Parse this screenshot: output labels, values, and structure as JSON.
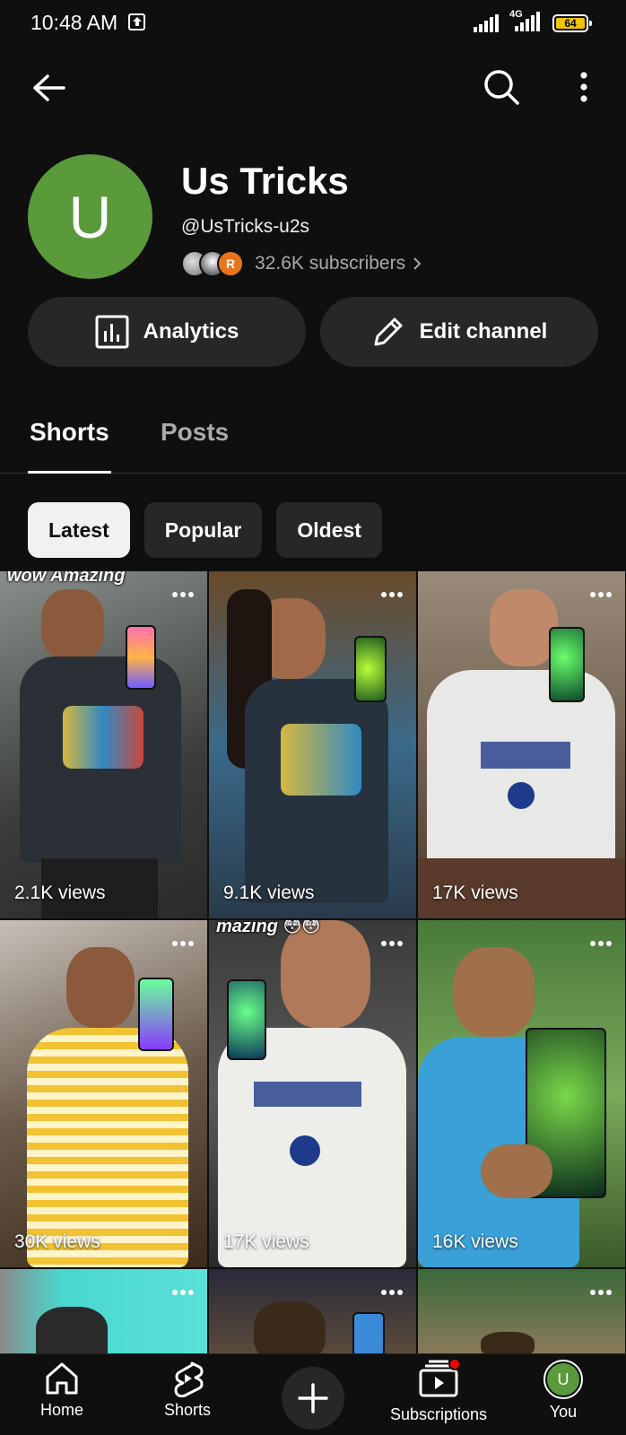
{
  "status_bar": {
    "time": "10:48 AM",
    "network": "4G",
    "battery": "64"
  },
  "top_bar": {
    "back_icon": "arrow-left-icon",
    "search_icon": "search-icon",
    "more_icon": "more-vert-icon"
  },
  "channel": {
    "avatar_letter": "U",
    "avatar_color": "#5a9a3a",
    "name": "Us Tricks",
    "handle": "@UsTricks-u2s",
    "subscribers": "32.6K subscribers",
    "subscriber_avatar_letter": "R"
  },
  "actions": {
    "analytics_label": "Analytics",
    "edit_label": "Edit channel"
  },
  "tabs": [
    {
      "label": "Shorts",
      "active": true
    },
    {
      "label": "Posts",
      "active": false
    }
  ],
  "chips": [
    {
      "label": "Latest",
      "selected": true
    },
    {
      "label": "Popular",
      "selected": false
    },
    {
      "label": "Oldest",
      "selected": false
    }
  ],
  "shorts": [
    {
      "views": "2.1K views",
      "caption": "wow Amazing"
    },
    {
      "views": "9.1K views",
      "caption": ""
    },
    {
      "views": "17K views",
      "caption": ""
    },
    {
      "views": "30K views",
      "caption": ""
    },
    {
      "views": "17K views",
      "caption": "mazing 😳😳"
    },
    {
      "views": "16K views",
      "caption": ""
    },
    {
      "views": "",
      "caption": ""
    },
    {
      "views": "",
      "caption": ""
    },
    {
      "views": "",
      "caption": ""
    }
  ],
  "bottom_nav": {
    "home": "Home",
    "shorts": "Shorts",
    "subscriptions": "Subscriptions",
    "you": "You",
    "you_letter": "U"
  },
  "colors": {
    "background": "#0f0f0f",
    "surface": "#272727",
    "accent_red": "#ff0000"
  }
}
